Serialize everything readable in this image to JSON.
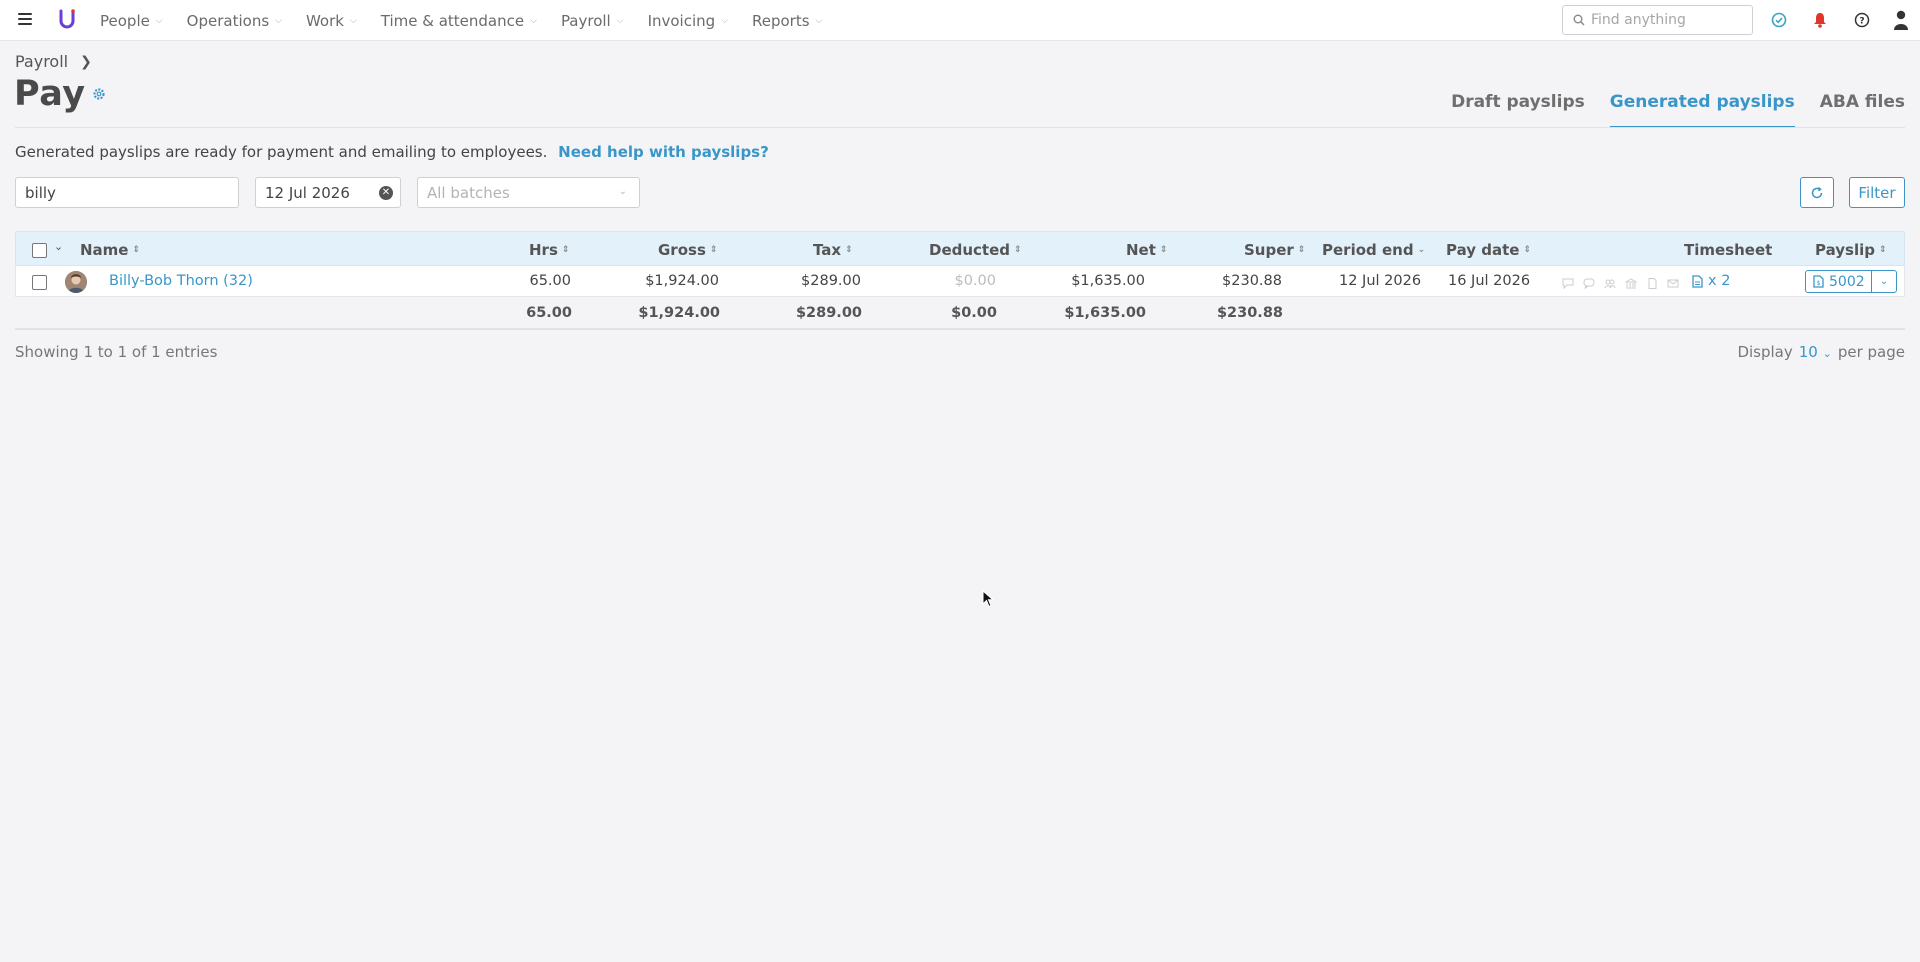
{
  "topnav": {
    "items": [
      "People",
      "Operations",
      "Work",
      "Time & attendance",
      "Payroll",
      "Invoicing",
      "Reports"
    ],
    "search_placeholder": "Find anything"
  },
  "header": {
    "breadcrumb": "Payroll",
    "title": "Pay",
    "tabs": [
      "Draft payslips",
      "Generated payslips",
      "ABA files"
    ],
    "active_tab": "Generated payslips"
  },
  "intro": {
    "text": "Generated payslips are ready for payment and emailing to employees.",
    "help_link": "Need help with payslips?"
  },
  "filters": {
    "search_value": "billy",
    "date_value": "12 Jul 2026",
    "batch_placeholder": "All batches",
    "filter_label": "Filter"
  },
  "table": {
    "columns": {
      "name": "Name",
      "hrs": "Hrs",
      "gross": "Gross",
      "tax": "Tax",
      "deducted": "Deducted",
      "net": "Net",
      "super": "Super",
      "period_end": "Period end",
      "pay_date": "Pay date",
      "timesheet": "Timesheet",
      "payslip": "Payslip"
    },
    "rows": [
      {
        "name": "Billy-Bob Thorn (32)",
        "hrs": "65.00",
        "gross": "$1,924.00",
        "tax": "$289.00",
        "deducted": "$0.00",
        "net": "$1,635.00",
        "super": "$230.88",
        "period_end": "12 Jul 2026",
        "pay_date": "16 Jul 2026",
        "timesheet": "x 2",
        "payslip": "5002"
      }
    ],
    "totals": {
      "hrs": "65.00",
      "gross": "$1,924.00",
      "tax": "$289.00",
      "deducted": "$0.00",
      "net": "$1,635.00",
      "super": "$230.88"
    }
  },
  "footer": {
    "showing": "Showing 1 to 1 of 1 entries",
    "display_label": "Display",
    "per_page_value": "10",
    "per_page_label": "per page"
  },
  "colors": {
    "accent": "#3a96c8",
    "header_bg": "#e3f1fa",
    "page_bg": "#f4f4f7",
    "notification": "#e0352b",
    "status_ok": "#3aa3c2",
    "logo": "#6b3fd6"
  }
}
